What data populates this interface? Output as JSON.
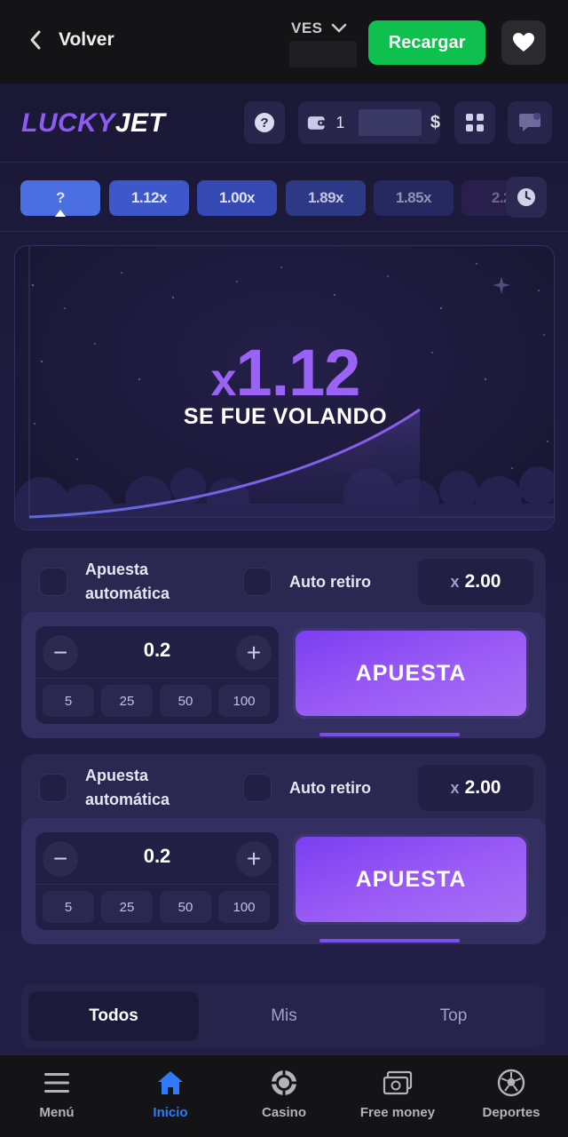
{
  "topbar": {
    "back_label": "Volver",
    "currency": "VES",
    "recargar_label": "Recargar"
  },
  "game_header": {
    "logo_lucky": "LUCKY",
    "logo_jet": "JET",
    "wallet_digit": "1",
    "wallet_currency": "$"
  },
  "history": [
    {
      "label": "?",
      "color": "#4b6ee0"
    },
    {
      "label": "1.12x",
      "color": "#3f58c9"
    },
    {
      "label": "1.00x",
      "color": "#3549b2"
    },
    {
      "label": "1.89x",
      "color": "#323f93"
    },
    {
      "label": "1.85x",
      "color": "#2e3479"
    },
    {
      "label": "2.2",
      "color": "#3a2a6a"
    }
  ],
  "flight": {
    "multiplier_prefix": "x",
    "multiplier": "1.12",
    "status": "SE FUE VOLANDO"
  },
  "bets": [
    {
      "auto_bet_label_1": "Apuesta",
      "auto_bet_label_2": "automática",
      "auto_cashout_label": "Auto retiro",
      "auto_cashout_prefix": "x",
      "auto_cashout_value": "2.00",
      "stake": "0.2",
      "minus": "−",
      "plus": "+",
      "chips": [
        "5",
        "25",
        "50",
        "100"
      ],
      "button_label": "APUESTA"
    },
    {
      "auto_bet_label_1": "Apuesta",
      "auto_bet_label_2": "automática",
      "auto_cashout_label": "Auto retiro",
      "auto_cashout_prefix": "x",
      "auto_cashout_value": "2.00",
      "stake": "0.2",
      "minus": "−",
      "plus": "+",
      "chips": [
        "5",
        "25",
        "50",
        "100"
      ],
      "button_label": "APUESTA"
    }
  ],
  "tabs": [
    "Todos",
    "Mis",
    "Top"
  ],
  "bottom_nav": [
    {
      "label": "Menú",
      "icon": "menu-icon"
    },
    {
      "label": "Inicio",
      "icon": "home-icon"
    },
    {
      "label": "Casino",
      "icon": "casino-chip-icon"
    },
    {
      "label": "Free money",
      "icon": "money-icon"
    },
    {
      "label": "Deportes",
      "icon": "soccer-ball-icon"
    }
  ],
  "colors": {
    "accent_purple": "#8d5af2",
    "recargar_green": "#10c04f",
    "nav_active_blue": "#2f7bff"
  }
}
